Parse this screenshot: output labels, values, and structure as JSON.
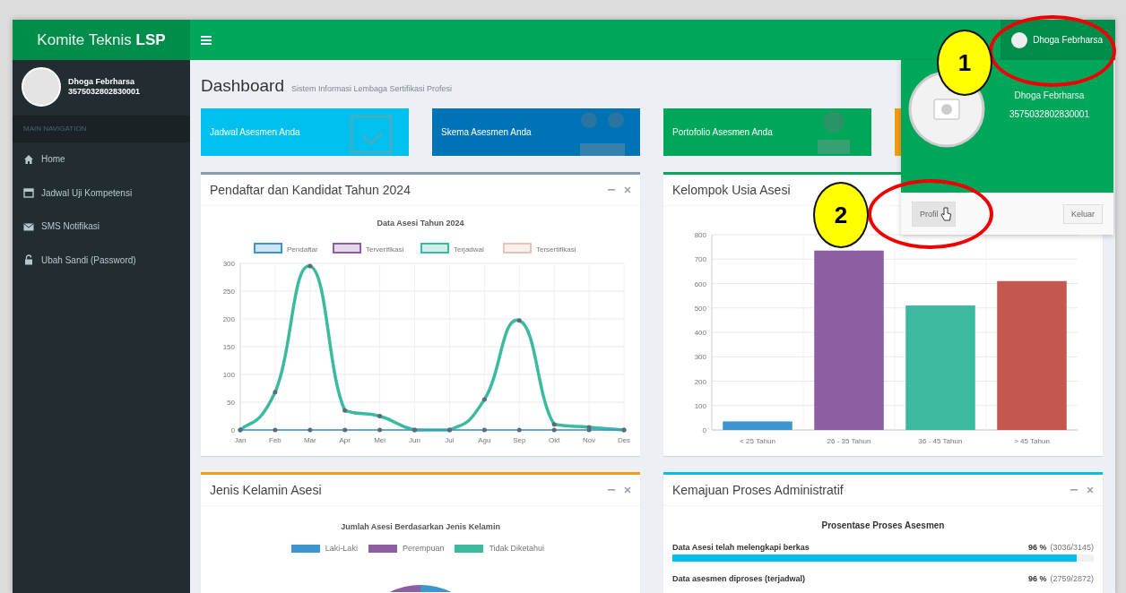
{
  "brand": {
    "text": "Komite Teknis **LSP**"
  },
  "user_menu": {
    "name": "Dhoga Febrharsa",
    "expanded": true,
    "dropdown": {
      "name": "Dhoga Febrharsa",
      "id_number": "3575032802830001",
      "buttons": [
        {
          "label": "Profil",
          "hovered": true
        },
        {
          "label": "Keluar",
          "hovered": false
        }
      ]
    }
  },
  "sidebar": {
    "user": {
      "name": "Dhoga Febrharsa",
      "id_number": "3575032802830001"
    },
    "header": "MAIN NAVIGATION",
    "items": [
      {
        "label": "Home",
        "selected": false
      },
      {
        "label": "Jadwal Uji Kompetensi",
        "selected": false
      },
      {
        "label": "SMS Notifikasi",
        "selected": false
      },
      {
        "label": "Ubah Sandi (Password)",
        "selected": false
      }
    ]
  },
  "page": {
    "title": "Dashboard",
    "subtitle": "Sistem Informasi Lembaga Sertifikasi Profesi"
  },
  "info_boxes": [
    {
      "label": "Jadwal Asesmen Anda",
      "color": "#00c0ef"
    },
    {
      "label": "Skema Asesmen Anda",
      "color": "#0073b7"
    },
    {
      "label": "Portofolio Asesmen Anda",
      "color": "#00a65a"
    },
    {
      "color": "#f39c12"
    }
  ],
  "boxes": [
    {
      "title": "Pendaftar dan Kandidat Tahun 2024",
      "color": "#8a9bab",
      "tools": true,
      "chart_data": {
        "type": "line",
        "title": "Data Asesi Tahun 2024",
        "grid": true,
        "legend": true,
        "categories": [
          "Jan",
          "Feb",
          "Mar",
          "Apr",
          "Mei",
          "Jun",
          "Jul",
          "Agu",
          "Sep",
          "Okt",
          "Nov",
          "Des"
        ],
        "ylim": [
          0,
          300
        ],
        "yticks": [
          0,
          50,
          100,
          150,
          200,
          250,
          300
        ],
        "series": [
          {
            "name": "Pendaftar",
            "color": "#3e95cd",
            "values": [
              0,
              0,
              0,
              0,
              0,
              0,
              0,
              0,
              0,
              0,
              0,
              0
            ]
          },
          {
            "name": "Terverifikasi",
            "color": "#8e5ea2",
            "values": [
              null,
              null,
              null,
              null,
              null,
              null,
              null,
              null,
              null,
              null,
              null,
              null
            ]
          },
          {
            "name": "Terjadwal",
            "color": "#3cba9f",
            "values": [
              0,
              68,
              295,
              35,
              25,
              0,
              0,
              55,
              197,
              10,
              5,
              0
            ]
          },
          {
            "name": "Tersertifikasi",
            "color": "#e8c3b9",
            "values": [
              null,
              null,
              null,
              null,
              null,
              null,
              null,
              null,
              null,
              null,
              null,
              null
            ]
          }
        ]
      }
    },
    {
      "title": "Kelompok Usia Asesi",
      "color": "#00a65a",
      "chart_data": {
        "type": "bar",
        "grid": true,
        "categories": [
          "< 25 Tahun",
          "26 - 35 Tahun",
          "36 - 45 Tahun",
          "> 45 Tahun"
        ],
        "ylim": [
          0,
          800
        ],
        "yticks": [
          0,
          100,
          200,
          300,
          400,
          500,
          600,
          700,
          800
        ],
        "series": [
          {
            "colors": [
              "#3e95cd",
              "#8e5ea2",
              "#3cba9f",
              "#c45850"
            ],
            "values": [
              35,
              735,
              510,
              610
            ]
          }
        ]
      }
    },
    {
      "title": "Jenis Kelamin Asesi",
      "color": "#f39c12",
      "tools": true,
      "kind": "pie",
      "chart_title": "Jumlah Asesi Berdasarkan Jenis Kelamin",
      "legend": [
        {
          "label": "Laki-Laki",
          "color": "#3e95cd"
        },
        {
          "label": "Perempuan",
          "color": "#8e5ea2"
        },
        {
          "label": "Tidak Diketahui",
          "color": "#3cba9f"
        }
      ]
    },
    {
      "title": "Kemajuan Proses Administratif",
      "color": "#00c0ef",
      "tools": true,
      "kind": "progress",
      "heading": "Prosentase Proses Asesmen",
      "rows": [
        {
          "label": "Data Asesi telah melengkapi berkas",
          "percent": "96 %",
          "count": "(3036/3145)",
          "level": 0.96
        },
        {
          "label": "Data asesmen diproses (terjadwal)",
          "percent": "96 %",
          "count": "(2759/2872)"
        }
      ]
    }
  ],
  "annotations": [
    {
      "label": "1"
    },
    {
      "label": "2"
    }
  ]
}
